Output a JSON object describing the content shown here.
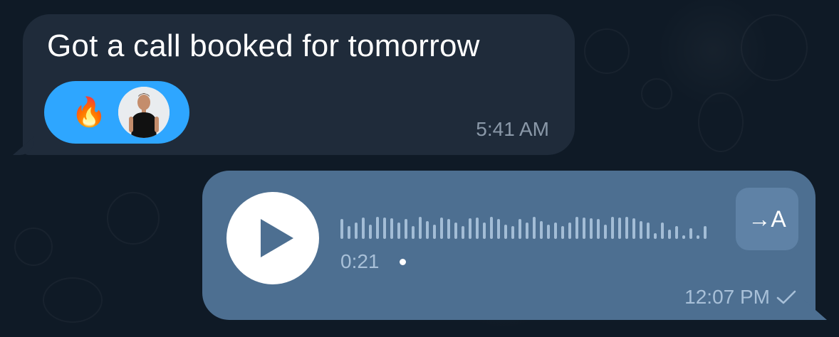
{
  "incoming_message": {
    "text": "Got a call booked for tomorrow",
    "time": "5:41 AM",
    "reaction": {
      "emoji": "🔥",
      "reactor_avatar": "person-avatar"
    }
  },
  "outgoing_voice_message": {
    "duration": "0:21",
    "time": "12:07 PM",
    "transcribe_label": "→A",
    "status_icon": "single-check-icon",
    "waveform_levels": [
      0.55,
      0.35,
      0.45,
      0.6,
      0.4,
      0.62,
      0.6,
      0.58,
      0.45,
      0.55,
      0.35,
      0.62,
      0.5,
      0.4,
      0.6,
      0.55,
      0.45,
      0.35,
      0.58,
      0.6,
      0.45,
      0.62,
      0.55,
      0.4,
      0.35,
      0.55,
      0.45,
      0.62,
      0.5,
      0.4,
      0.45,
      0.35,
      0.45,
      0.62,
      0.6,
      0.58,
      0.55,
      0.4,
      0.62,
      0.6,
      0.62,
      0.58,
      0.5,
      0.45,
      0.15,
      0.45,
      0.25,
      0.35,
      0.1,
      0.3,
      0.1,
      0.35
    ],
    "colors": {
      "bubble": "#4d6f91",
      "waveform": "#a3bdd6",
      "play_button": "#ffffff"
    }
  },
  "colors": {
    "incoming_bubble": "#1f2b3a",
    "reaction_pill": "#2ea6ff",
    "background": "#0f1a26"
  }
}
